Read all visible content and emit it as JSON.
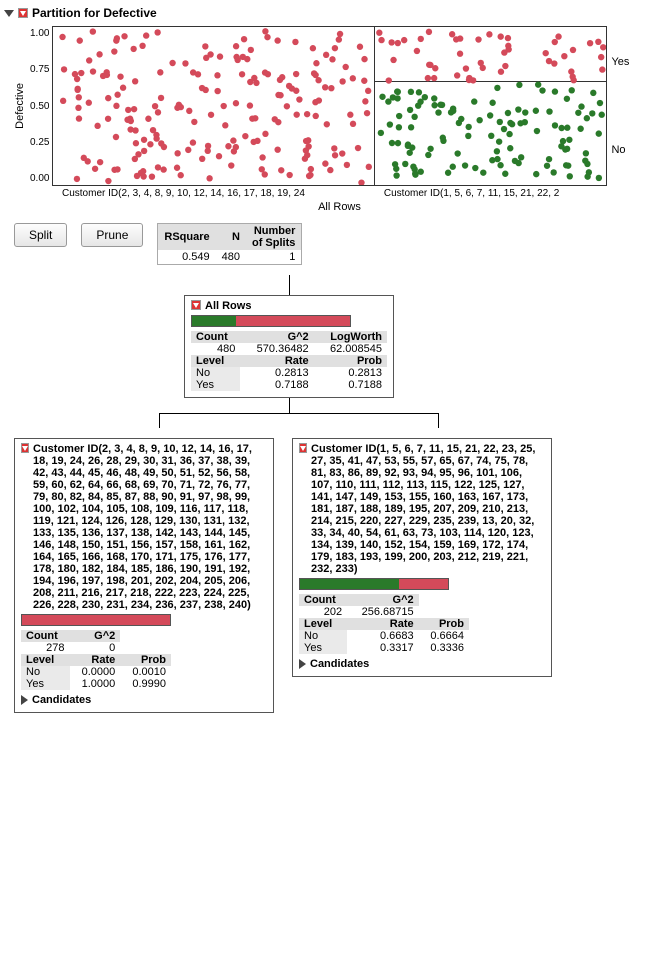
{
  "header": {
    "title": "Partition for Defective"
  },
  "chart": {
    "ylabel": "Defective",
    "yticks": [
      "1.00",
      "0.75",
      "0.50",
      "0.25",
      "0.00"
    ],
    "xlabel": "All Rows",
    "xl_left": "Customer ID(2, 3, 4, 8, 9, 10, 12, 14, 16, 17, 18, 19, 24",
    "xl_right": "Customer ID(1, 5, 6, 7, 11, 15, 21, 22, 2",
    "right_yes": "Yes",
    "right_no": "No"
  },
  "buttons": {
    "split": "Split",
    "prune": "Prune"
  },
  "stats": {
    "h_rsq": "RSquare",
    "h_n": "N",
    "h_splits_l1": "Number",
    "h_splits_l2": "of Splits",
    "rsq": "0.549",
    "n": "480",
    "splits": "1"
  },
  "root": {
    "title": "All Rows",
    "count_h": "Count",
    "g2_h": "G^2",
    "lw_h": "LogWorth",
    "count": "480",
    "g2": "570.36482",
    "lw": "62.008545",
    "lvl_h": "Level",
    "rate_h": "Rate",
    "prob_h": "Prob",
    "no_lvl": "No",
    "no_rate": "0.2813",
    "no_prob": "0.2813",
    "yes_lvl": "Yes",
    "yes_rate": "0.7188",
    "yes_prob": "0.7188"
  },
  "left": {
    "title": "Customer ID(2, 3, 4, 8, 9, 10, 12, 14, 16, 17, 18, 19, 24, 26, 28, 29, 30, 31, 36, 37, 38, 39, 42, 43, 44, 45, 46, 48, 49, 50, 51, 52, 56, 58, 59, 60, 62, 64, 66, 68, 69, 70, 71, 72, 76, 77, 79, 80, 82, 84, 85, 87, 88, 90, 91, 97, 98, 99, 100, 102, 104, 105, 108, 109, 116, 117, 118, 119, 121, 124, 126, 128, 129, 130, 131, 132, 133, 135, 136, 137, 138, 142, 143, 144, 145, 146, 148, 150, 151, 156, 157, 158, 161, 162, 164, 165, 166, 168, 170, 171, 175, 176, 177, 178, 180, 182, 184, 185, 186, 190, 191, 192, 194, 196, 197, 198, 201, 202, 204, 205, 206, 208, 211, 216, 217, 218, 222, 223, 224, 225, 226, 228, 230, 231, 234, 236, 237, 238, 240)",
    "count_h": "Count",
    "g2_h": "G^2",
    "count": "278",
    "g2": "0",
    "lvl_h": "Level",
    "rate_h": "Rate",
    "prob_h": "Prob",
    "no_lvl": "No",
    "no_rate": "0.0000",
    "no_prob": "0.0010",
    "yes_lvl": "Yes",
    "yes_rate": "1.0000",
    "yes_prob": "0.9990",
    "cand": "Candidates"
  },
  "right": {
    "title": "Customer ID(1, 5, 6, 7, 11, 15, 21, 22, 23, 25, 27, 35, 41, 47, 53, 55, 57, 65, 67, 74, 75, 78, 81, 83, 86, 89, 92, 93, 94, 95, 96, 101, 106, 107, 110, 111, 112, 113, 115, 122, 125, 127, 141, 147, 149, 153, 155, 160, 163, 167, 173, 181, 187, 188, 189, 195, 207, 209, 210, 213, 214, 215, 220, 227, 229, 235, 239, 13, 20, 32, 33, 34, 40, 54, 61, 63, 73, 103, 114, 120, 123, 134, 139, 140, 152, 154, 159, 169, 172, 174, 179, 183, 193, 199, 200, 203, 212, 219, 221, 232, 233)",
    "count_h": "Count",
    "g2_h": "G^2",
    "count": "202",
    "g2": "256.68715",
    "lvl_h": "Level",
    "rate_h": "Rate",
    "prob_h": "Prob",
    "no_lvl": "No",
    "no_rate": "0.6683",
    "no_prob": "0.6664",
    "yes_lvl": "Yes",
    "yes_rate": "0.3317",
    "yes_prob": "0.3336",
    "cand": "Candidates"
  },
  "chart_data": {
    "type": "scatter",
    "title": "Partition for Defective",
    "ylabel": "Defective",
    "xlabel": "All Rows",
    "ylim": [
      0,
      1
    ],
    "series": [
      {
        "name": "Yes",
        "color": "#d44a5a"
      },
      {
        "name": "No",
        "color": "#2a7a2a"
      }
    ],
    "partitions": [
      {
        "label": "Customer ID(2, 3, 4, 8, 9, 10, 12, 14, 16, 17, 18, 19, 24, ...)",
        "yes_rate": 1.0,
        "no_rate": 0.0,
        "n": 278
      },
      {
        "label": "Customer ID(1, 5, 6, 7, 11, 15, 21, 22, 2, ...)",
        "yes_rate": 0.3317,
        "no_rate": 0.6683,
        "n": 202,
        "split_y": 0.66
      }
    ]
  }
}
